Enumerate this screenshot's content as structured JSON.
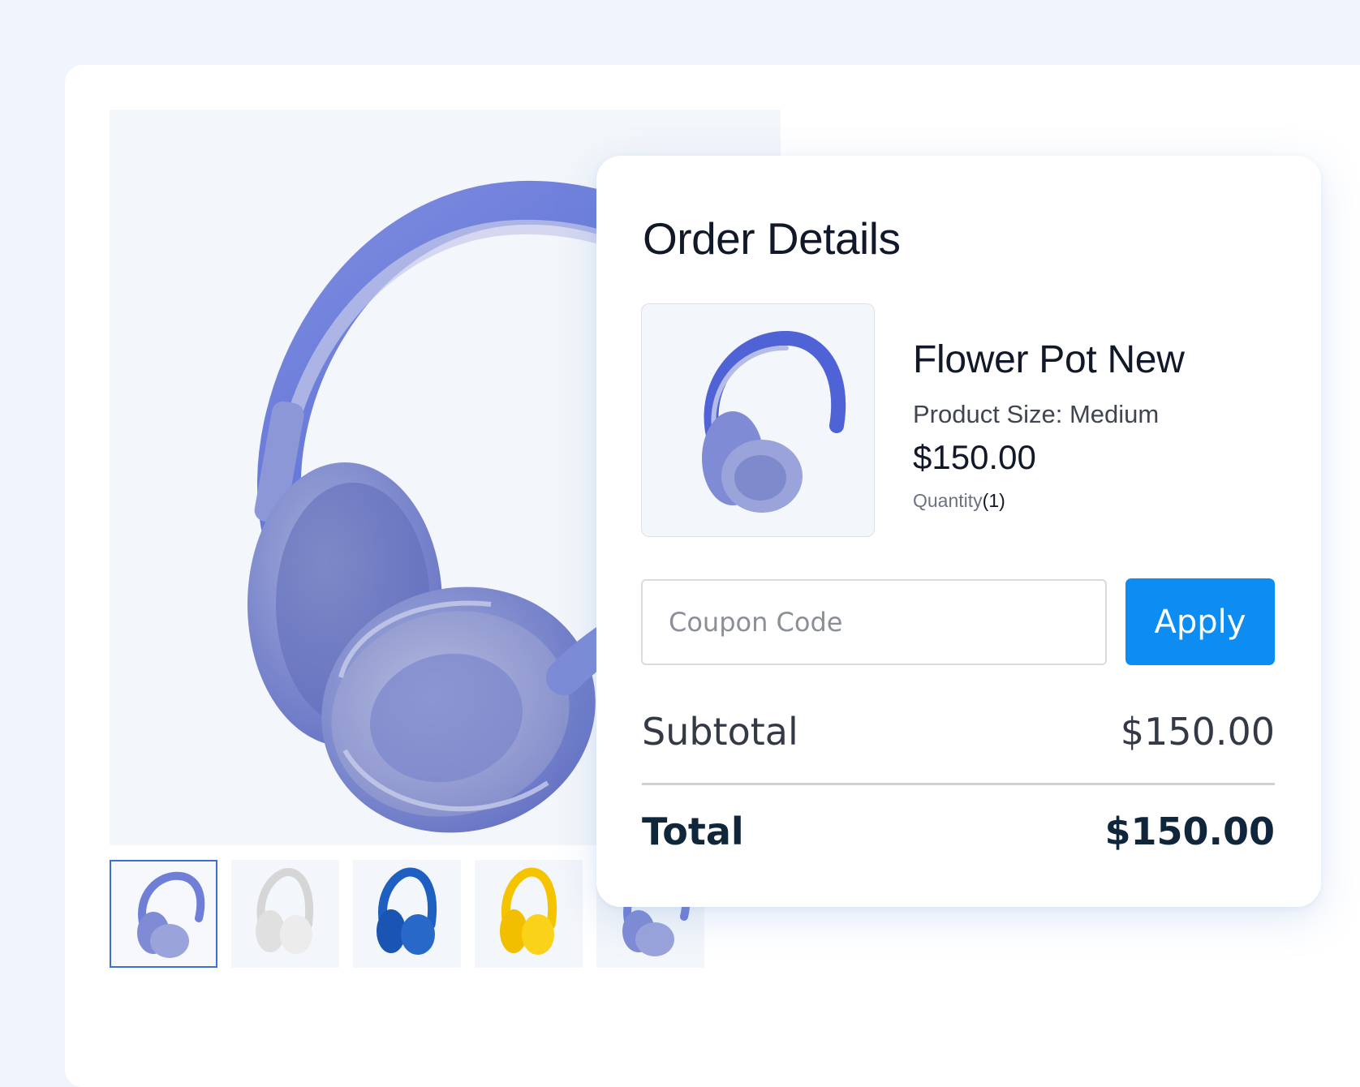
{
  "gallery": {
    "thumbnails": [
      {
        "color": "#6f7ed6",
        "label": "blue-lavender",
        "active": true
      },
      {
        "color": "#e2e2e2",
        "label": "white",
        "active": false
      },
      {
        "color": "#1f5fc2",
        "label": "blue",
        "active": false
      },
      {
        "color": "#f5c400",
        "label": "yellow",
        "active": false
      },
      {
        "color": "#6f7ed6",
        "label": "blue-lavender",
        "active": false
      }
    ]
  },
  "order": {
    "title": "Order Details",
    "product": {
      "name": "Flower Pot New",
      "size": "Product Size: Medium",
      "price": "$150.00",
      "quantity_label": "Quantity",
      "quantity_value": "(1)"
    },
    "coupon": {
      "placeholder": "Coupon Code",
      "value": "",
      "apply_label": "Apply"
    },
    "subtotal": {
      "label": "Subtotal",
      "value": "$150.00"
    },
    "total": {
      "label": "Total",
      "value": "$150.00"
    }
  },
  "colors": {
    "accent": "#0d8df2",
    "active_thumb_border": "#3b6fd6",
    "total_text": "#10263a"
  }
}
